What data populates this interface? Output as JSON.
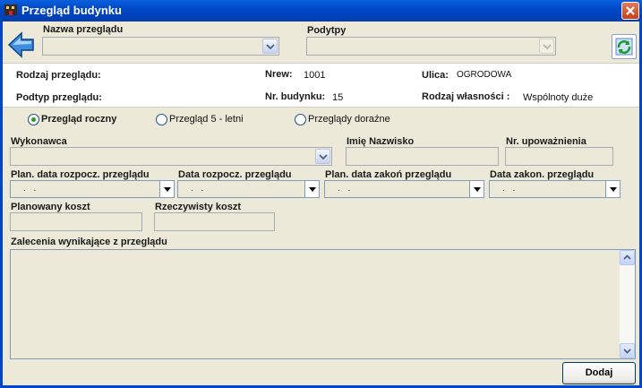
{
  "window": {
    "title": "Przegląd budynku"
  },
  "header": {
    "nazwa_label": "Nazwa przeglądu",
    "nazwa_value": "",
    "podtypy_label": "Podytpy",
    "podtypy_value": ""
  },
  "info": {
    "rodzaj_label": "Rodzaj przeglądu:",
    "rodzaj_value": "",
    "podtyp_label": "Podtyp przeglądu:",
    "podtyp_value": "",
    "nrew_label": "Nrew:",
    "nrew_value": "1001",
    "nrbud_label": "Nr. budynku:",
    "nrbud_value": "15",
    "ulica_label": "Ulica:",
    "ulica_value": "OGRODOWA",
    "wlasnosc_label": "Rodzaj własności :",
    "wlasnosc_value": "Wspólnoty duże"
  },
  "radios": {
    "r1": "Przegląd roczny",
    "r2": "Przegląd 5 - letni",
    "r3": "Przeglądy doraźne",
    "selected": "r1"
  },
  "form": {
    "wykonawca_label": "Wykonawca",
    "imie_label": "Imię Nazwisko",
    "nr_upow_label": "Nr. upoważnienia",
    "plan_rozp_label": "Plan. data rozpocz. przeglądu",
    "data_rozp_label": "Data rozpocz. przeglądu",
    "plan_zak_label": "Plan. data zakoń przeglądu",
    "data_zak_label": "Data zakon. przeglądu",
    "date_placeholder": ". .",
    "plan_koszt_label": "Planowany koszt",
    "rzecz_koszt_label": "Rzeczywisty koszt",
    "zalecenia_label": "Zalecenia wynikające z przeglądu"
  },
  "buttons": {
    "dodaj": "Dodaj"
  },
  "colors": {
    "titlebar": "#0048c8",
    "panel": "#ece9d8",
    "accent_radio": "#21a121"
  }
}
